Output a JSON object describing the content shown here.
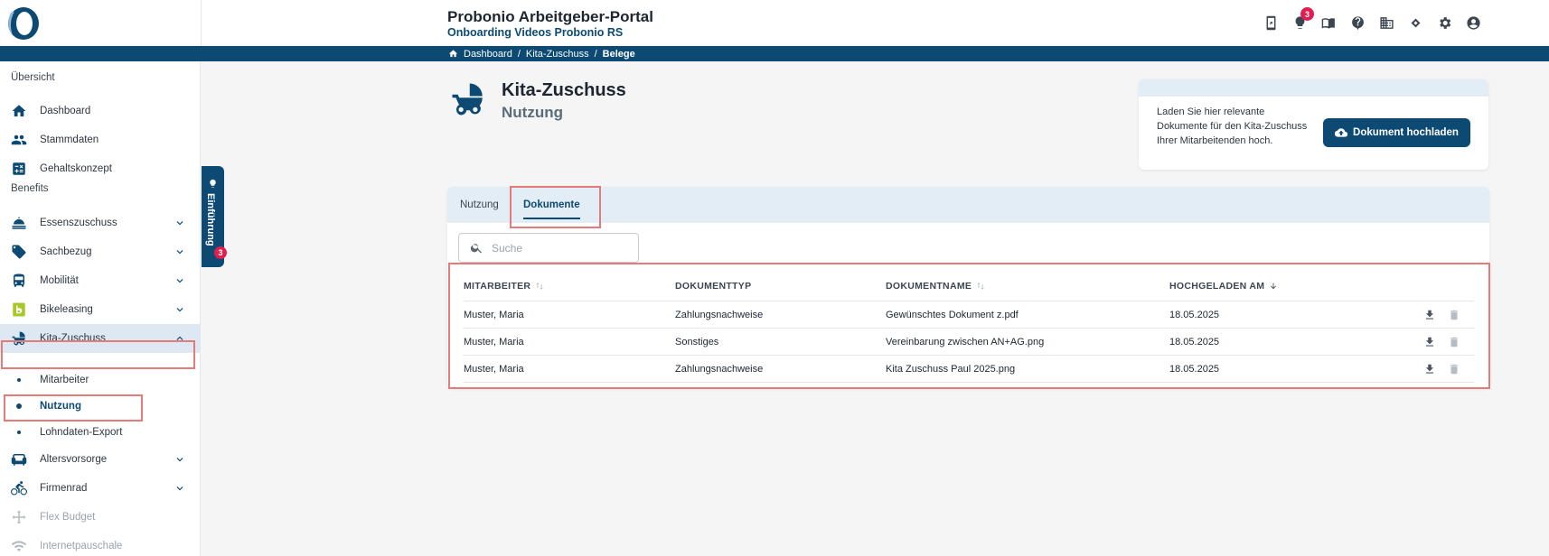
{
  "header": {
    "title": "Probonio Arbeitgeber-Portal",
    "subtitle": "Onboarding Videos Probonio RS",
    "icons": [
      "phone-icon",
      "lightbulb-icon",
      "book-icon",
      "help-icon",
      "building-icon",
      "handshake-icon",
      "gear-icon",
      "account-icon"
    ],
    "notification_count": "3"
  },
  "breadcrumb": {
    "items": [
      "Dashboard",
      "Kita-Zuschuss",
      "Belege"
    ]
  },
  "sidebar": {
    "section_overview": "Übersicht",
    "overview_items": [
      {
        "label": "Dashboard",
        "icon": "home-icon"
      },
      {
        "label": "Stammdaten",
        "icon": "people-icon"
      },
      {
        "label": "Gehaltskonzept",
        "icon": "calculator-icon"
      }
    ],
    "section_benefits": "Benefits",
    "benefit_items": [
      {
        "label": "Essenszuschuss",
        "icon": "food-icon"
      },
      {
        "label": "Sachbezug",
        "icon": "tag-icon"
      },
      {
        "label": "Mobilität",
        "icon": "bus-icon"
      },
      {
        "label": "Bikeleasing",
        "icon": "bikeleasing-icon"
      },
      {
        "label": "Kita-Zuschuss",
        "icon": "stroller-icon"
      }
    ],
    "kita_sub_items": [
      "Mitarbeiter",
      "Nutzung",
      "Lohndaten-Export"
    ],
    "more_items": [
      {
        "label": "Altersvorsorge",
        "icon": "sofa-icon"
      },
      {
        "label": "Firmenrad",
        "icon": "bicycle-icon"
      },
      {
        "label": "Flex Budget",
        "icon": "flex-icon"
      },
      {
        "label": "Internetpauschale",
        "icon": "wifi-icon"
      }
    ]
  },
  "intro_tab": {
    "label": "Einführung",
    "badge": "3"
  },
  "page": {
    "title": "Kita-Zuschuss",
    "subtitle": "Nutzung"
  },
  "upload": {
    "text": "Laden Sie hier relevante Dokumente für den Kita-Zuschuss Ihrer Mitarbeitenden hoch.",
    "button_label": "Dokument hochladen"
  },
  "tabs": [
    "Nutzung",
    "Dokumente"
  ],
  "search": {
    "placeholder": "Suche"
  },
  "table": {
    "columns": [
      "MITARBEITER",
      "DOKUMENTTYP",
      "DOKUMENTNAME",
      "HOCHGELADEN AM"
    ],
    "rows": [
      {
        "employee": "Muster, Maria",
        "type": "Zahlungsnachweise",
        "name": "Gewünschtes Dokument z.pdf",
        "date": "18.05.2025"
      },
      {
        "employee": "Muster, Maria",
        "type": "Sonstiges",
        "name": "Vereinbarung zwischen AN+AG.png",
        "date": "18.05.2025"
      },
      {
        "employee": "Muster, Maria",
        "type": "Zahlungsnachweise",
        "name": "Kita Zuschuss Paul 2025.png",
        "date": "18.05.2025"
      }
    ]
  },
  "colors": {
    "brand": "#0d4a73",
    "highlight": "#e57a7a",
    "badge": "#e01f4f"
  }
}
